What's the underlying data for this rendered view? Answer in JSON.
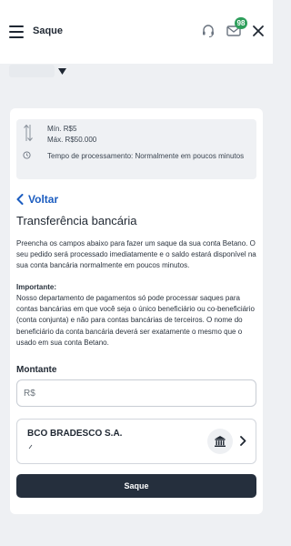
{
  "header": {
    "title": "Saque",
    "notification_count": "98",
    "icons": {
      "menu": "hamburger-icon",
      "support": "headset-icon",
      "messages": "mail-icon",
      "close": "close-icon"
    }
  },
  "limits": {
    "min": "Mín. R$5",
    "max": "Máx. R$50.000",
    "processing": "Tempo de processamento: Normalmente em poucos minutos"
  },
  "nav": {
    "back_label": "Voltar"
  },
  "section": {
    "title": "Transferência bancária",
    "intro": "Preencha os campos abaixo para fazer um saque da sua conta Betano. O seu pedido será processado imediatamente e o saldo estará disponível na sua conta bancária normalmente em poucos minutos.",
    "important_title": "Importante:",
    "important_text": "Nosso departamento de pagamentos só pode processar saques para contas bancárias em que você seja o único beneficiário ou co-beneficiário (conta conjunta) e não para contas bancárias de terceiros. O nome do beneficiário da conta bancária deverá ser exatamente o mesmo que o usado em sua conta Betano."
  },
  "form": {
    "amount_label": "Montante",
    "amount_placeholder": "R$",
    "amount_value": ""
  },
  "bank": {
    "name": "BCO BRADESCO S.A.",
    "icon": "bank-building-icon"
  },
  "submit_label": "Saque",
  "colors": {
    "accent_link": "#1c5dc0",
    "badge": "#2e9e5b",
    "button": "#252f3d",
    "background": "#eef0f3"
  }
}
